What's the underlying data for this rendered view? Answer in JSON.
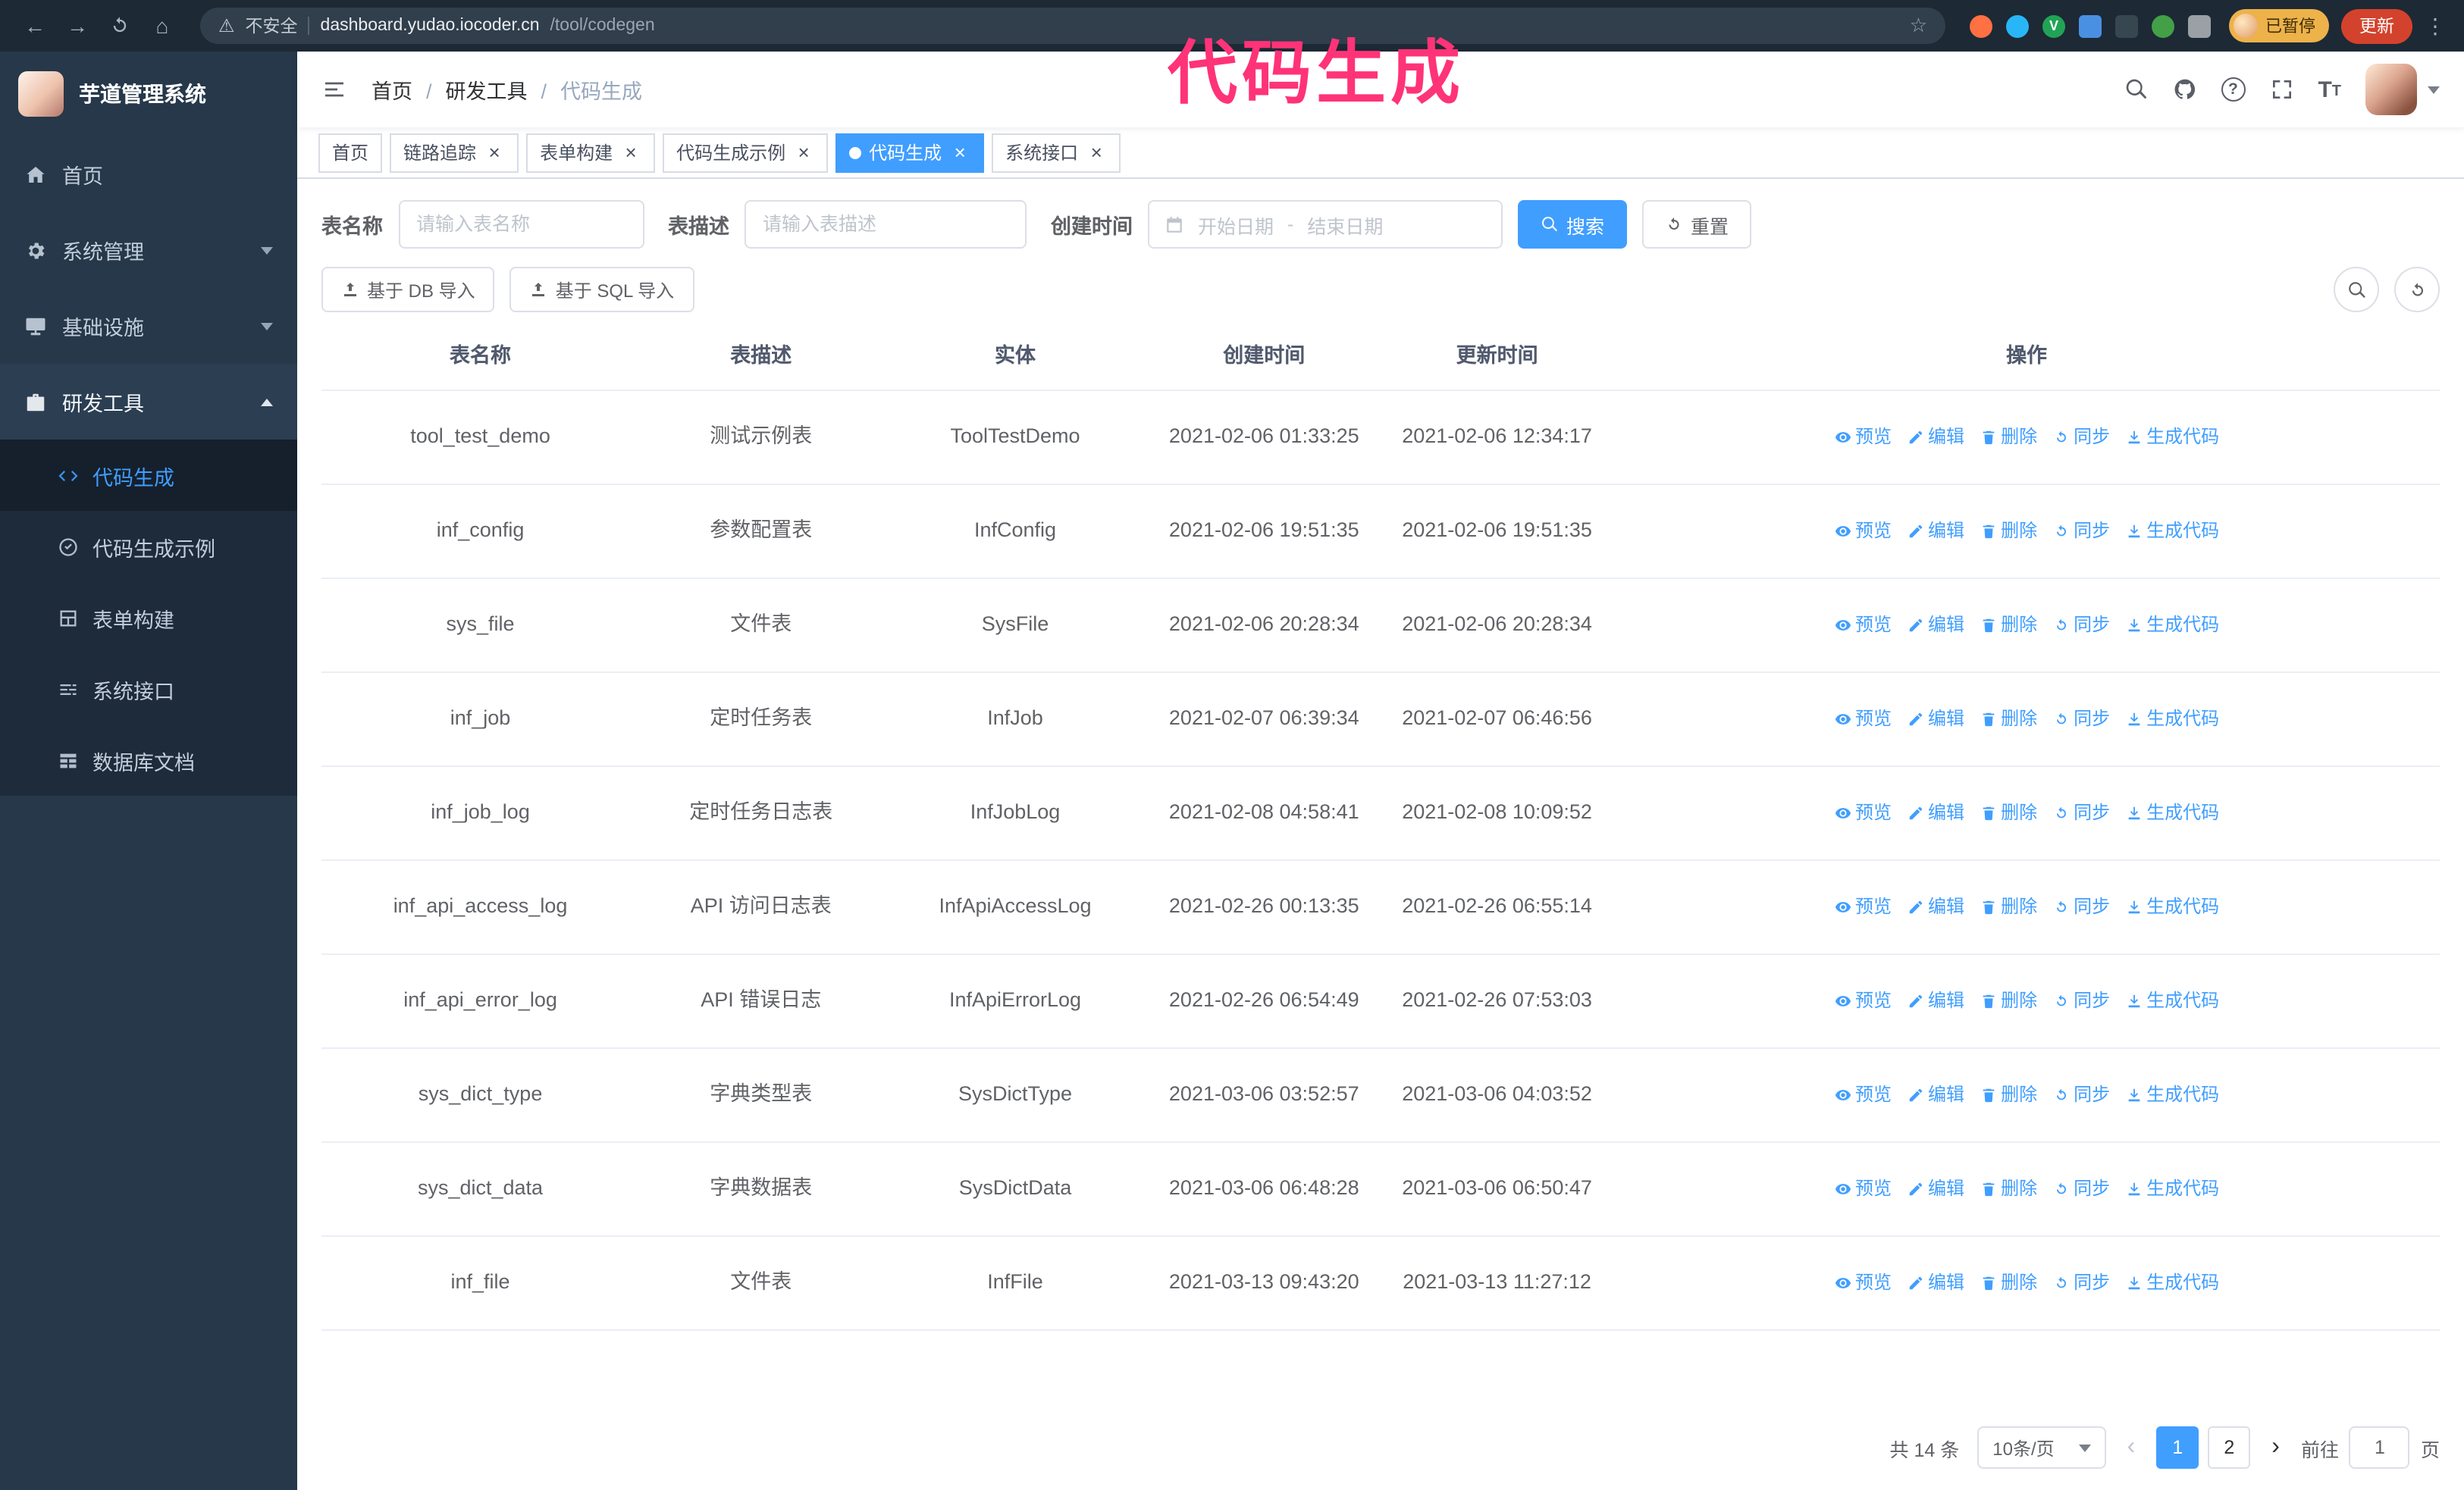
{
  "annotation": {
    "text": "代码生成"
  },
  "colors": {
    "accent": "#409eff",
    "annotation_pink": "#ff3377",
    "sidebar_bg": "#263849",
    "active_tab": "#409eff"
  },
  "browser": {
    "security_label": "不安全",
    "url_host": "dashboard.yudao.iocoder.cn",
    "url_path": "/tool/codegen",
    "profile_badge": "已暂停",
    "update_label": "更新"
  },
  "sidebar": {
    "logo_title": "芋道管理系统",
    "items": [
      {
        "label": "首页"
      },
      {
        "label": "系统管理"
      },
      {
        "label": "基础设施"
      },
      {
        "label": "研发工具"
      }
    ],
    "submenu": [
      {
        "label": "代码生成",
        "active": true
      },
      {
        "label": "代码生成示例"
      },
      {
        "label": "表单构建"
      },
      {
        "label": "系统接口"
      },
      {
        "label": "数据库文档"
      }
    ]
  },
  "navbar": {
    "breadcrumb": [
      {
        "label": "首页"
      },
      {
        "label": "研发工具"
      },
      {
        "label": "代码生成",
        "current": true
      }
    ]
  },
  "tabs": [
    {
      "label": "首页"
    },
    {
      "label": "链路追踪",
      "closable": true
    },
    {
      "label": "表单构建",
      "closable": true
    },
    {
      "label": "代码生成示例",
      "closable": true
    },
    {
      "label": "代码生成",
      "closable": true,
      "active": true
    },
    {
      "label": "系统接口",
      "closable": true
    }
  ],
  "search_form": {
    "table_name_label": "表名称",
    "table_name_placeholder": "请输入表名称",
    "table_desc_label": "表描述",
    "table_desc_placeholder": "请输入表描述",
    "create_time_label": "创建时间",
    "start_date_placeholder": "开始日期",
    "range_separator": "-",
    "end_date_placeholder": "结束日期",
    "search_label": "搜索",
    "reset_label": "重置"
  },
  "toolbar": {
    "import_db_label": "基于 DB 导入",
    "import_sql_label": "基于 SQL 导入"
  },
  "table": {
    "columns": [
      "表名称",
      "表描述",
      "实体",
      "创建时间",
      "更新时间",
      "操作"
    ],
    "actions": [
      {
        "label": "预览",
        "icon": "eye-icon",
        "eye": true
      },
      {
        "label": "编辑",
        "icon": "edit-icon",
        "edit": true
      },
      {
        "label": "删除",
        "icon": "delete-icon",
        "del": true
      },
      {
        "label": "同步",
        "icon": "sync-icon",
        "sync": true
      },
      {
        "label": "生成代码",
        "icon": "download-icon",
        "gen": true
      }
    ],
    "rows": [
      {
        "name": "tool_test_demo",
        "desc": "测试示例表",
        "entity": "ToolTestDemo",
        "created": "2021-02-06 01:33:25",
        "updated": "2021-02-06 12:34:17"
      },
      {
        "name": "inf_config",
        "desc": "参数配置表",
        "entity": "InfConfig",
        "created": "2021-02-06 19:51:35",
        "updated": "2021-02-06 19:51:35"
      },
      {
        "name": "sys_file",
        "desc": "文件表",
        "entity": "SysFile",
        "created": "2021-02-06 20:28:34",
        "updated": "2021-02-06 20:28:34"
      },
      {
        "name": "inf_job",
        "desc": "定时任务表",
        "entity": "InfJob",
        "created": "2021-02-07 06:39:34",
        "updated": "2021-02-07 06:46:56"
      },
      {
        "name": "inf_job_log",
        "desc": "定时任务日志表",
        "entity": "InfJobLog",
        "created": "2021-02-08 04:58:41",
        "updated": "2021-02-08 10:09:52"
      },
      {
        "name": "inf_api_access_log",
        "desc": "API 访问日志表",
        "entity": "InfApiAccessLog",
        "created": "2021-02-26 00:13:35",
        "updated": "2021-02-26 06:55:14"
      },
      {
        "name": "inf_api_error_log",
        "desc": "API 错误日志",
        "entity": "InfApiErrorLog",
        "created": "2021-02-26 06:54:49",
        "updated": "2021-02-26 07:53:03"
      },
      {
        "name": "sys_dict_type",
        "desc": "字典类型表",
        "entity": "SysDictType",
        "created": "2021-03-06 03:52:57",
        "updated": "2021-03-06 04:03:52"
      },
      {
        "name": "sys_dict_data",
        "desc": "字典数据表",
        "entity": "SysDictData",
        "created": "2021-03-06 06:48:28",
        "updated": "2021-03-06 06:50:47"
      },
      {
        "name": "inf_file",
        "desc": "文件表",
        "entity": "InfFile",
        "created": "2021-03-13 09:43:20",
        "updated": "2021-03-13 11:27:12"
      }
    ]
  },
  "pagination": {
    "total_label": "共 14 条",
    "page_size_label": "10条/页",
    "pages": [
      {
        "label": "1",
        "active": true
      },
      {
        "label": "2"
      }
    ],
    "goto_label": "前往",
    "goto_value": "1",
    "page_unit": "页"
  }
}
